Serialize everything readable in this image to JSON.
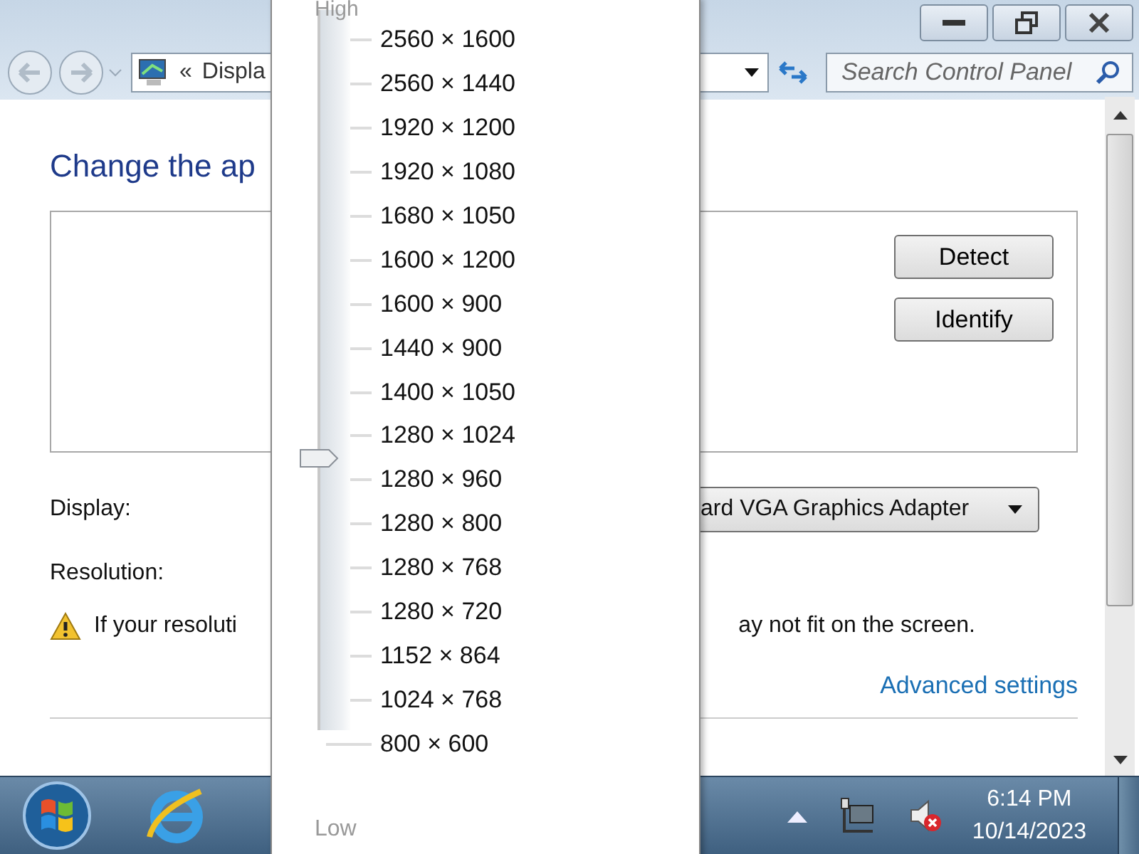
{
  "address_bar": {
    "breadcrumb_chevron": "«",
    "breadcrumb": "Displa",
    "search": {
      "placeholder": "Search Control Panel"
    }
  },
  "heading": "Change the ap",
  "monitor_buttons": [
    "Detect",
    "Identify"
  ],
  "display_field": {
    "label": "Display:",
    "value": "ard VGA Graphics Adapter"
  },
  "resolution_field": {
    "label": "Resolution:"
  },
  "warning": {
    "left": "If your resoluti",
    "right": "ay not fit on the screen."
  },
  "advanced_link": "Advanced settings",
  "resolution_popup": {
    "high_label": "High",
    "low_label": "Low",
    "slider": {
      "level": 0.375
    },
    "options": [
      "2560 × 1600",
      "2560 × 1440",
      "1920 × 1200",
      "1920 × 1080",
      "1680 × 1050",
      "1600 × 1200",
      "1600 × 900",
      "1440 × 900",
      "1400 × 1050",
      "1280 × 1024",
      "1280 × 960",
      "1280 × 800",
      "1280 × 768",
      "1280 × 720",
      "1152 × 864",
      "1024 × 768",
      "800 × 600"
    ]
  },
  "taskbar": {
    "clock": {
      "time": "6:14 PM",
      "date": "10/14/2023"
    }
  }
}
